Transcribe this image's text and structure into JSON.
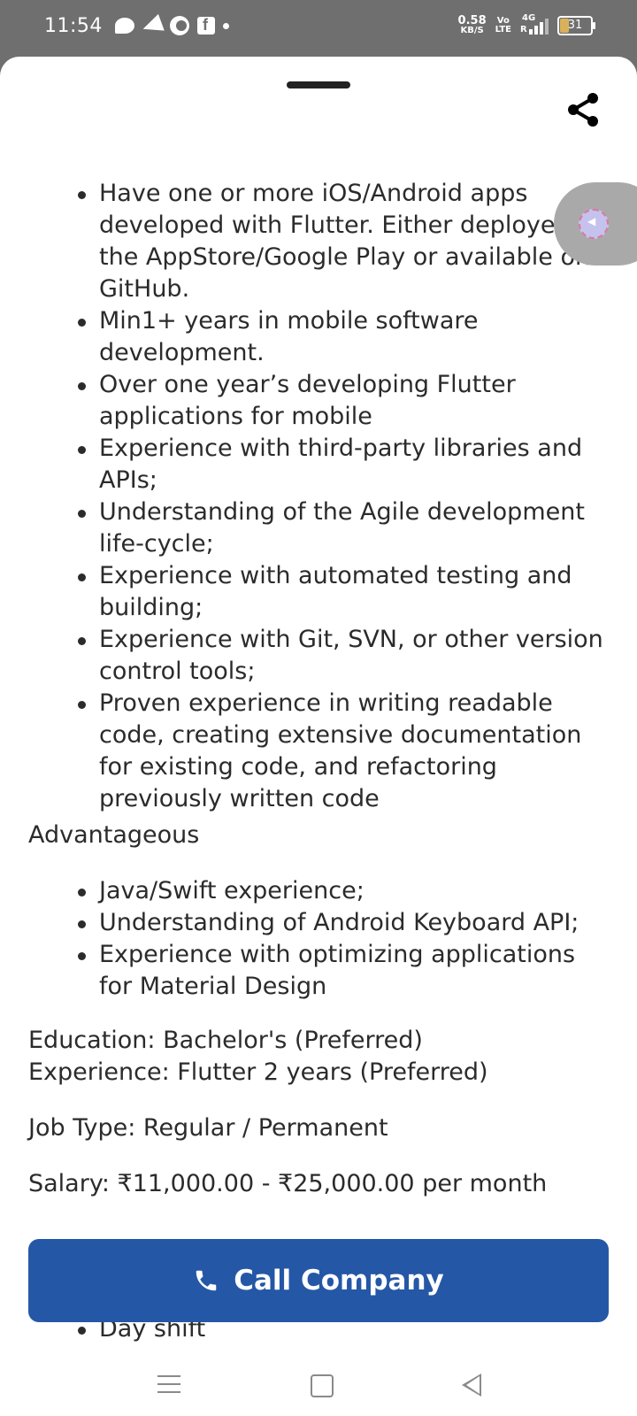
{
  "status_bar": {
    "time": "11:54",
    "net_speed_value": "0.58",
    "net_speed_unit": "KB/S",
    "volte_top": "Vo",
    "volte_bottom": "LTE",
    "network_type": "4G",
    "roaming": "R",
    "battery": "31",
    "notification_icons": [
      "chat-icon",
      "telegram-icon",
      "c-app-icon",
      "facebook-icon",
      "dot-icon"
    ]
  },
  "requirements": [
    "Have one or more iOS/Android apps developed with Flutter. Either deployed on the AppStore/Google Play or available on GitHub.",
    "Min1+ years in mobile software development.",
    "Over one year’s developing Flutter applications for mobile",
    "Experience with third-party libraries and APIs;",
    "Understanding of the Agile development life-cycle;",
    "Experience with automated testing and building;",
    "Experience with Git, SVN, or other version control tools;",
    "Proven experience in writing readable code, creating extensive documentation for existing code, and refactoring previously written code"
  ],
  "advantageous_heading": "Advantageous",
  "advantageous": [
    "Java/Swift experience;",
    "Understanding of Android Keyboard API;",
    "Experience with optimizing applications for Material Design"
  ],
  "education": "Education: Bachelor's (Preferred)",
  "experience": "Experience: Flutter 2 years (Preferred)",
  "job_type": "Job Type: Regular / Permanent",
  "salary": "Salary: ₹11,000.00 - ₹25,000.00 per month",
  "peek_item": "Day shift",
  "call_button_label": "Call Company",
  "colors": {
    "accent": "#2557a7",
    "status_bar": "#6f6f6f",
    "text": "#2b2b2b"
  }
}
